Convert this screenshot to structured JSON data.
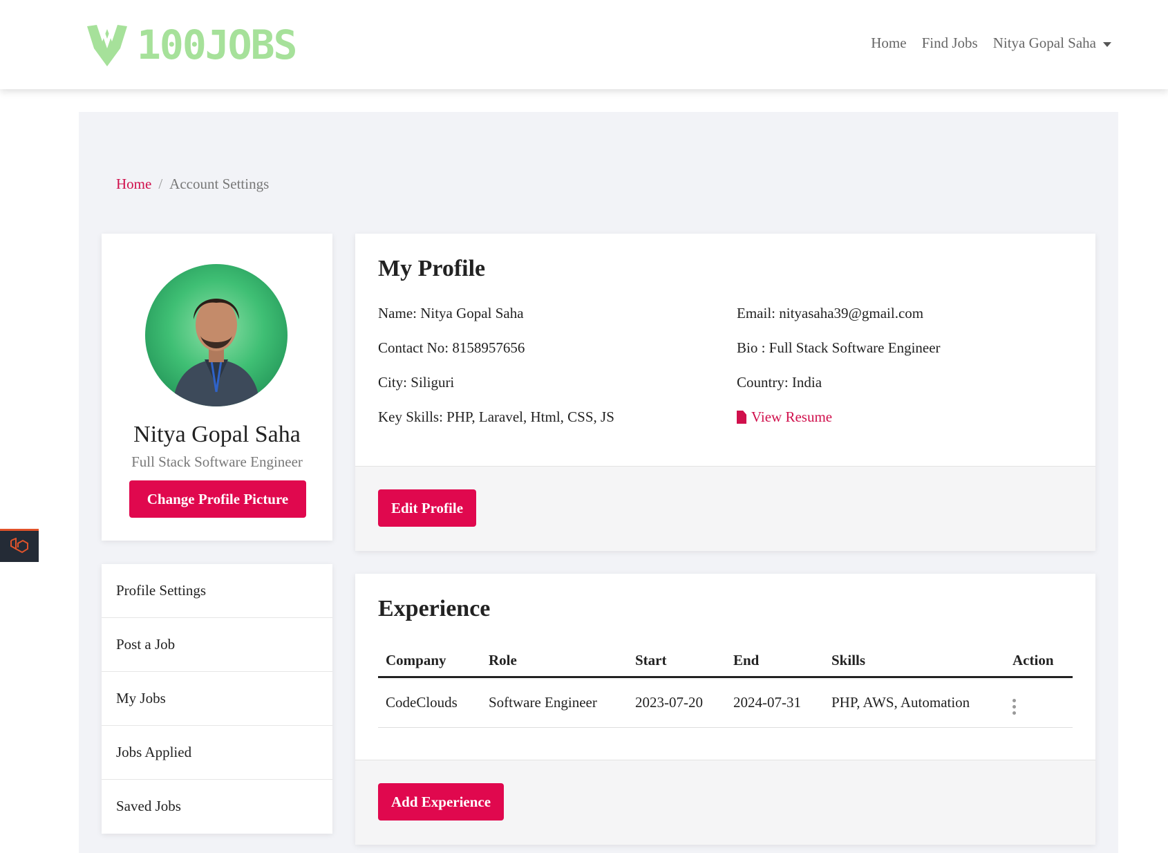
{
  "header": {
    "logo_text": "100JOBS",
    "nav": {
      "home": "Home",
      "find_jobs": "Find Jobs",
      "user_menu": "Nitya Gopal Saha"
    }
  },
  "breadcrumb": {
    "home": "Home",
    "separator": "/",
    "current": "Account Settings"
  },
  "profile_card": {
    "name": "Nitya Gopal Saha",
    "title": "Full Stack Software Engineer",
    "change_picture_label": "Change Profile Picture"
  },
  "sidebar_menu": {
    "items": [
      {
        "label": "Profile Settings"
      },
      {
        "label": "Post a Job"
      },
      {
        "label": "My Jobs"
      },
      {
        "label": "Jobs Applied"
      },
      {
        "label": "Saved Jobs"
      }
    ]
  },
  "my_profile": {
    "title": "My Profile",
    "name": "Name: Nitya Gopal Saha",
    "contact": "Contact No: 8158957656",
    "city": "City: Siliguri",
    "skills": "Key Skills: PHP, Laravel, Html, CSS, JS",
    "email": "Email: nityasaha39@gmail.com",
    "bio": "Bio : Full Stack Software Engineer",
    "country": "Country: India",
    "resume_label": "View Resume",
    "edit_label": "Edit Profile"
  },
  "experience": {
    "title": "Experience",
    "headers": {
      "company": "Company",
      "role": "Role",
      "start": "Start",
      "end": "End",
      "skills": "Skills",
      "action": "Action"
    },
    "rows": [
      {
        "company": "CodeClouds",
        "role": "Software Engineer",
        "start": "2023-07-20",
        "end": "2024-07-31",
        "skills": "PHP, AWS, Automation"
      }
    ],
    "add_label": "Add Experience"
  },
  "colors": {
    "accent": "#e0084e",
    "link": "#d0104c",
    "logo": "#a6e19a",
    "page_bg": "#f2f3f7"
  }
}
